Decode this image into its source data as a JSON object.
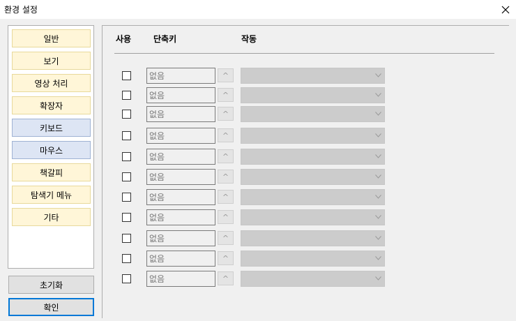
{
  "window": {
    "title": "환경 설정"
  },
  "sidebar": {
    "items": [
      {
        "label": "일반",
        "style": "yellow"
      },
      {
        "label": "보기",
        "style": "yellow"
      },
      {
        "label": "영상 처리",
        "style": "yellow"
      },
      {
        "label": "확장자",
        "style": "yellow"
      },
      {
        "label": "키보드",
        "style": "blue"
      },
      {
        "label": "마우스",
        "style": "blue"
      },
      {
        "label": "책갈피",
        "style": "yellow"
      },
      {
        "label": "탐색기 메뉴",
        "style": "yellow"
      },
      {
        "label": "기타",
        "style": "yellow"
      }
    ]
  },
  "buttons": {
    "reset": "초기화",
    "ok": "확인"
  },
  "table": {
    "headers": {
      "enabled": "사용",
      "shortcut": "단축키",
      "action": "작동"
    },
    "rows": [
      {
        "enabled": false,
        "shortcut": "없음",
        "key_button": "^",
        "action": ""
      },
      {
        "enabled": false,
        "shortcut": "없음",
        "key_button": "^",
        "action": ""
      },
      {
        "enabled": false,
        "shortcut": "없음",
        "key_button": "^",
        "action": ""
      },
      {
        "enabled": false,
        "shortcut": "없음",
        "key_button": "^",
        "action": ""
      },
      {
        "enabled": false,
        "shortcut": "없음",
        "key_button": "^",
        "action": ""
      },
      {
        "enabled": false,
        "shortcut": "없음",
        "key_button": "^",
        "action": ""
      },
      {
        "enabled": false,
        "shortcut": "없음",
        "key_button": "^",
        "action": ""
      },
      {
        "enabled": false,
        "shortcut": "없음",
        "key_button": "^",
        "action": ""
      },
      {
        "enabled": false,
        "shortcut": "없음",
        "key_button": "^",
        "action": ""
      },
      {
        "enabled": false,
        "shortcut": "없음",
        "key_button": "^",
        "action": ""
      },
      {
        "enabled": false,
        "shortcut": "없음",
        "key_button": "^",
        "action": ""
      }
    ]
  },
  "colors": {
    "sidebar_yellow": "#fff6d8",
    "sidebar_blue": "#dde5f4",
    "focus_border": "#0078d7"
  }
}
